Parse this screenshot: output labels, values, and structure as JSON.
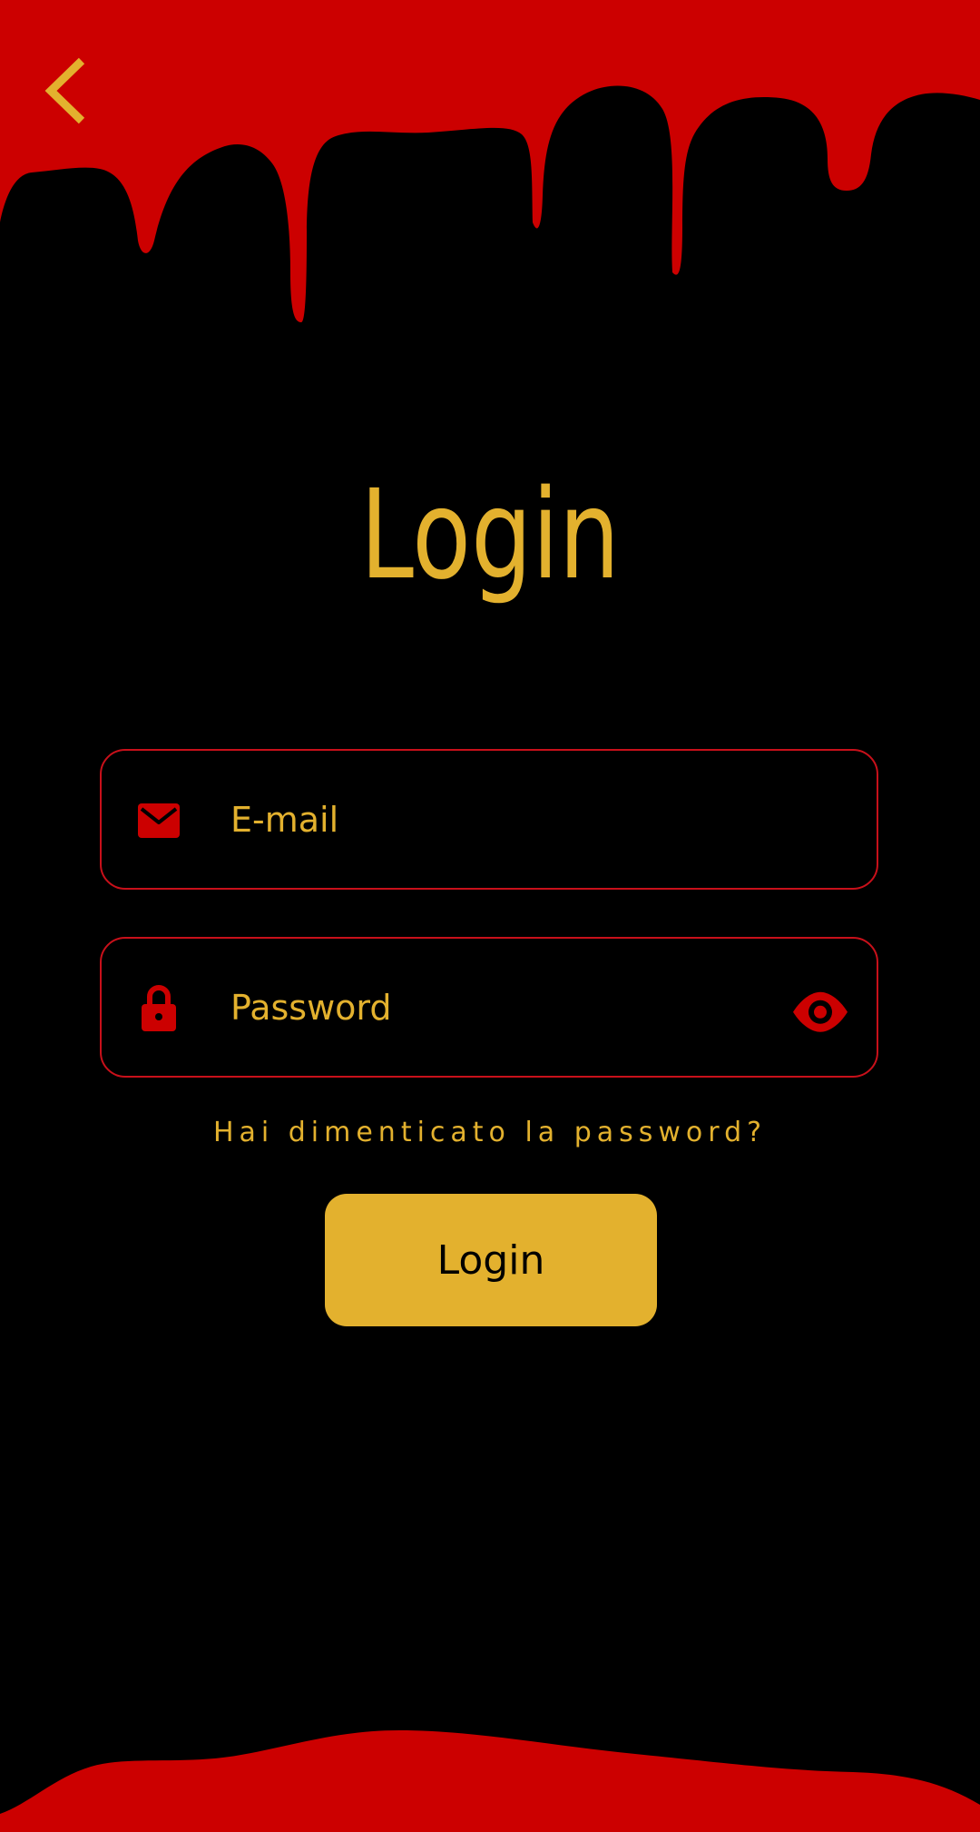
{
  "colors": {
    "background": "#000000",
    "accent_red": "#CC0000",
    "border_red": "#C8101A",
    "accent_gold": "#E3B12E"
  },
  "header": {
    "back_icon": "chevron-left-icon"
  },
  "title": "Login",
  "form": {
    "email": {
      "icon": "envelope-icon",
      "value": "",
      "placeholder": "E-mail"
    },
    "password": {
      "icon": "lock-icon",
      "value": "",
      "placeholder": "Password",
      "toggle_icon": "eye-icon"
    },
    "forgot_password": "Hai dimenticato la password?",
    "submit_label": "Login"
  }
}
